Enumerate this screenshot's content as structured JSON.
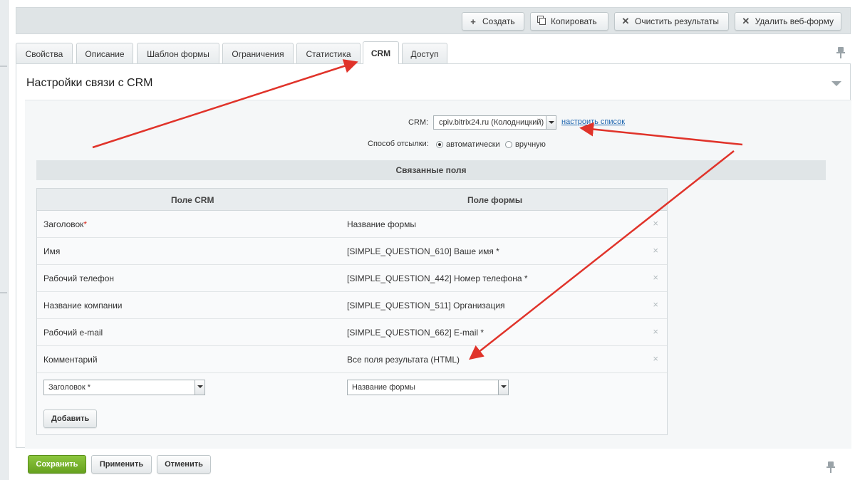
{
  "toolbar": {
    "create": {
      "icon": "plus-icon",
      "label": "Создать"
    },
    "copy": {
      "icon": "copy-icon",
      "label": "Копировать"
    },
    "clear_results": {
      "icon": "close-icon",
      "label": "Очистить результаты"
    },
    "delete_form": {
      "icon": "close-icon",
      "label": "Удалить веб-форму"
    }
  },
  "tabs": [
    {
      "label": "Свойства",
      "active": false
    },
    {
      "label": "Описание",
      "active": false
    },
    {
      "label": "Шаблон формы",
      "active": false
    },
    {
      "label": "Ограничения",
      "active": false
    },
    {
      "label": "Статистика",
      "active": false
    },
    {
      "label": "CRM",
      "active": true
    },
    {
      "label": "Доступ",
      "active": false
    }
  ],
  "panel": {
    "title": "Настройки связи с CRM",
    "crm_label": "CRM:",
    "crm_value": "cpiv.bitrix24.ru (Колодницкий)",
    "configure_link": "настроить список",
    "send_method_label": "Способ отсылки:",
    "send_methods": [
      {
        "label": "автоматически",
        "selected": true
      },
      {
        "label": "вручную",
        "selected": false
      }
    ],
    "linked_fields_title": "Связанные поля"
  },
  "table": {
    "headers": [
      "Поле CRM",
      "Поле формы"
    ],
    "rows": [
      {
        "crm_field": "Заголовок",
        "required_mark": "*",
        "form_field": "Название формы"
      },
      {
        "crm_field": "Имя",
        "required_mark": "",
        "form_field": "[SIMPLE_QUESTION_610] Ваше имя *"
      },
      {
        "crm_field": "Рабочий телефон",
        "required_mark": "",
        "form_field": "[SIMPLE_QUESTION_442] Номер телефона *"
      },
      {
        "crm_field": "Название компании",
        "required_mark": "",
        "form_field": "[SIMPLE_QUESTION_511] Организация"
      },
      {
        "crm_field": "Рабочий e-mail",
        "required_mark": "",
        "form_field": "[SIMPLE_QUESTION_662] E-mail *"
      },
      {
        "crm_field": "Комментарий",
        "required_mark": "",
        "form_field": "Все поля результата (HTML)"
      }
    ],
    "remove_symbol": "×",
    "new_crm_field": "Заголовок *",
    "new_form_field": "Название формы",
    "add_button": "Добавить"
  },
  "footer": {
    "save": "Сохранить",
    "apply": "Применить",
    "cancel": "Отменить"
  },
  "colors": {
    "save_button": "#76b12b",
    "annotation_arrow": "#e0332a",
    "link": "#2067b0"
  }
}
